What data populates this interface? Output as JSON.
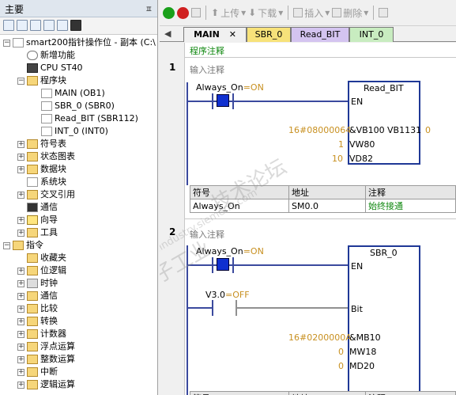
{
  "panel": {
    "title": "主要",
    "pin": "ㅍ",
    "toolbar_icons": [
      "view-icon",
      "list-icon",
      "doc-icon",
      "doc2-icon",
      "doc3-icon",
      "monitor-icon"
    ],
    "tree": [
      {
        "label": "smart200指针操作位 - 副本 (C:\\",
        "level": 0,
        "exp": "−",
        "icon": "project-icon"
      },
      {
        "label": "新增功能",
        "level": 1,
        "exp": "",
        "icon": "help-icon"
      },
      {
        "label": "CPU ST40",
        "level": 1,
        "exp": "",
        "icon": "cpu-icon"
      },
      {
        "label": "程序块",
        "level": 1,
        "exp": "−",
        "icon": "folder-icon"
      },
      {
        "label": "MAIN (OB1)",
        "level": 2,
        "exp": "",
        "icon": "doc-icon"
      },
      {
        "label": "SBR_0 (SBR0)",
        "level": 2,
        "exp": "",
        "icon": "doc-icon"
      },
      {
        "label": "Read_BIT (SBR112)",
        "level": 2,
        "exp": "",
        "icon": "doc-icon"
      },
      {
        "label": "INT_0 (INT0)",
        "level": 2,
        "exp": "",
        "icon": "doc-icon"
      },
      {
        "label": "符号表",
        "level": 1,
        "exp": "+",
        "icon": "folder-icon"
      },
      {
        "label": "状态图表",
        "level": 1,
        "exp": "+",
        "icon": "folder-icon"
      },
      {
        "label": "数据块",
        "level": 1,
        "exp": "+",
        "icon": "folder-icon"
      },
      {
        "label": "系统块",
        "level": 1,
        "exp": "",
        "icon": "doc-icon"
      },
      {
        "label": "交叉引用",
        "level": 1,
        "exp": "+",
        "icon": "folder-icon"
      },
      {
        "label": "通信",
        "level": 1,
        "exp": "",
        "icon": "monitor-icon"
      },
      {
        "label": "向导",
        "level": 1,
        "exp": "+",
        "icon": "wizard-icon"
      },
      {
        "label": "工具",
        "level": 1,
        "exp": "+",
        "icon": "folder-icon"
      },
      {
        "label": "指令",
        "level": 0,
        "exp": "−",
        "icon": "folder-icon"
      },
      {
        "label": "收藏夹",
        "level": 1,
        "exp": "",
        "icon": "folder-icon"
      },
      {
        "label": "位逻辑",
        "level": 1,
        "exp": "+",
        "icon": "folder-icon"
      },
      {
        "label": "时钟",
        "level": 1,
        "exp": "+",
        "icon": "clock-icon"
      },
      {
        "label": "通信",
        "level": 1,
        "exp": "+",
        "icon": "folder-icon"
      },
      {
        "label": "比较",
        "level": 1,
        "exp": "+",
        "icon": "folder-icon"
      },
      {
        "label": "转换",
        "level": 1,
        "exp": "+",
        "icon": "folder-icon"
      },
      {
        "label": "计数器",
        "level": 1,
        "exp": "+",
        "icon": "folder-icon"
      },
      {
        "label": "浮点运算",
        "level": 1,
        "exp": "+",
        "icon": "folder-icon"
      },
      {
        "label": "整数运算",
        "level": 1,
        "exp": "+",
        "icon": "folder-icon"
      },
      {
        "label": "中断",
        "level": 1,
        "exp": "+",
        "icon": "folder-icon"
      },
      {
        "label": "逻辑运算",
        "level": 1,
        "exp": "+",
        "icon": "folder-icon"
      }
    ]
  },
  "toolbar": {
    "upload": "上传",
    "download": "下载",
    "insert": "插入",
    "delete": "删除",
    "run_color": "#1aa01a",
    "stop_color": "#d02020"
  },
  "tabs": {
    "nav": "◀",
    "items": [
      {
        "label": "MAIN",
        "close": "✕",
        "color": "#f0f0f0"
      },
      {
        "label": "SBR_0",
        "color": "#f7e27a"
      },
      {
        "label": "Read_BIT",
        "color": "#d4c4f0"
      },
      {
        "label": "INT_0",
        "color": "#c8ecc0"
      }
    ]
  },
  "editor": {
    "program_comment": "程序注释",
    "networks": [
      {
        "number": "1",
        "comment": "输入注释",
        "contact_label": "Always_On",
        "contact_state": "=ON",
        "box_title": "Read_BIT",
        "en": "EN",
        "params": [
          {
            "value": "16#08000064",
            "name": "&VB100"
          },
          {
            "value": "1",
            "name": "VW80"
          },
          {
            "value": "10",
            "name": "VD82"
          }
        ],
        "out_name": "VB1131",
        "out_value": "0",
        "symtable": {
          "headers": [
            "符号",
            "地址",
            "注释"
          ],
          "rows": [
            [
              "Always_On",
              "SM0.0",
              "始终接通"
            ]
          ]
        }
      },
      {
        "number": "2",
        "comment": "输入注释",
        "contact_label": "Always_On",
        "contact_state": "=ON",
        "contact2_label": "V3.0",
        "contact2_state": "=OFF",
        "box_title": "SBR_0",
        "en": "EN",
        "bit": "Bit",
        "params": [
          {
            "value": "16#0200000A",
            "name": "&MB10"
          },
          {
            "value": "0",
            "name": "MW18"
          },
          {
            "value": "0",
            "name": "MD20"
          }
        ],
        "symtable": {
          "headers": [
            "符号",
            "地址",
            "注释"
          ]
        }
      }
    ]
  },
  "watermark": [
    "西门子工业",
    "技术论坛",
    "support.industry.siemens.com"
  ]
}
